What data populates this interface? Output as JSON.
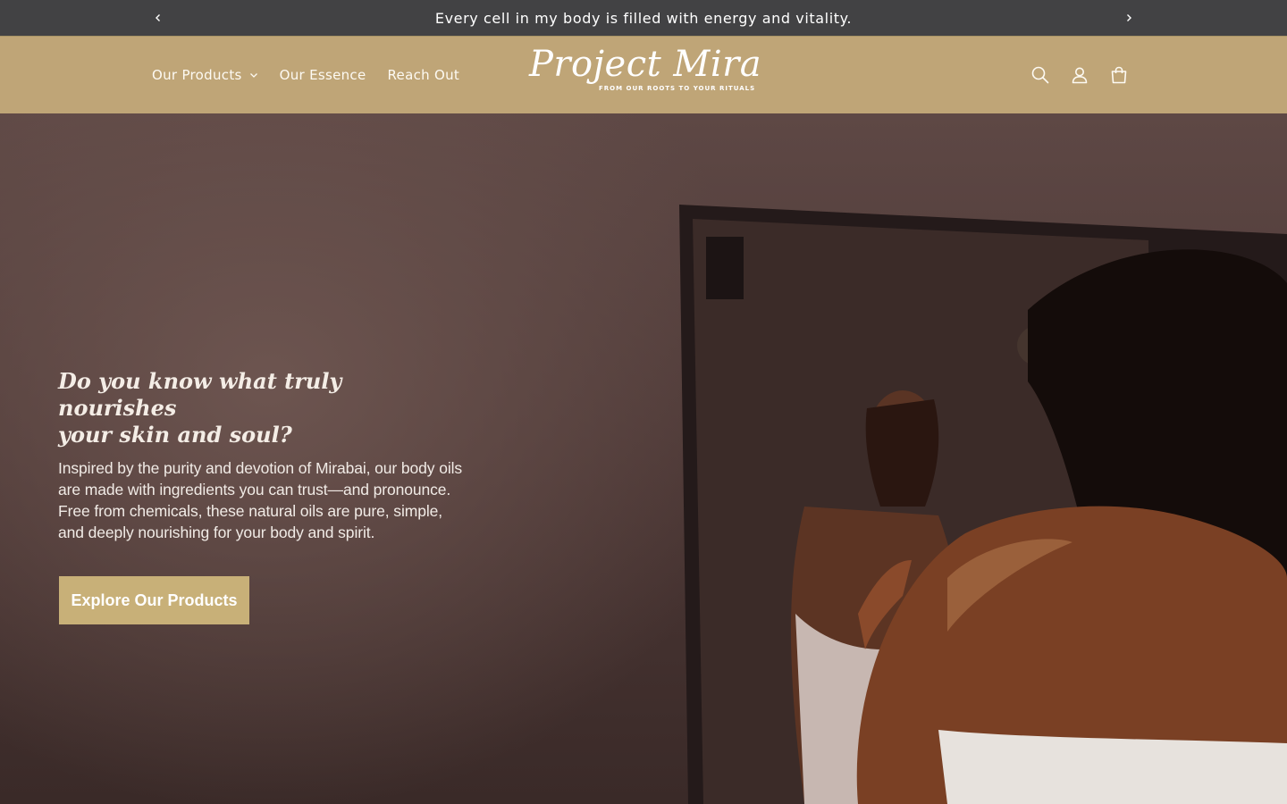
{
  "announcement": {
    "text": "Every cell in my body is filled with energy and vitality.",
    "prev_icon": "chevron-left-icon",
    "next_icon": "chevron-right-icon"
  },
  "header": {
    "nav": [
      {
        "label": "Our Products",
        "has_dropdown": true
      },
      {
        "label": "Our Essence"
      },
      {
        "label": "Reach Out"
      }
    ],
    "logo": {
      "title": "Project Mira",
      "tagline": "FROM OUR ROOTS TO YOUR RITUALS"
    },
    "icons": [
      "search-icon",
      "account-icon",
      "cart-icon"
    ]
  },
  "hero": {
    "heading_line1": "Do you know what truly nourishes",
    "heading_line2": "your skin and soul?",
    "body_line1": "Inspired by the purity and devotion of Mirabai, our body oils",
    "body_line2": "are made with ingredients you can trust—and pronounce.",
    "body_line3": "Free from chemicals, these natural oils are pure, simple,",
    "body_line4": "and deeply nourishing for your body and spirit.",
    "cta_label": "Explore Our Products"
  },
  "colors": {
    "announcement_bg": "#424244",
    "header_bg": "#bfa577",
    "cta_bg": "#c8b078",
    "hero_bg": "#4f3b38"
  }
}
